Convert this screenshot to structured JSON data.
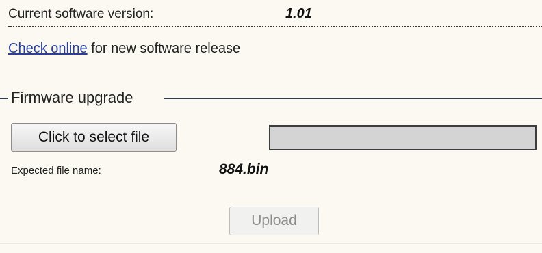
{
  "version": {
    "label": "Current software version:",
    "value": "1.01"
  },
  "check": {
    "link_text": "Check online",
    "suffix_text": " for new software release"
  },
  "firmware": {
    "title": "Firmware upgrade",
    "select_button_label": "Click to select file",
    "file_field_value": "",
    "expected_label": "Expected file name:",
    "expected_value": "884.bin",
    "upload_button_label": "Upload"
  },
  "colors": {
    "background": "#fbf9f1",
    "link": "#2a3f9b",
    "file_field": "#d4d4d4",
    "disabled_text": "#8d8d8d"
  }
}
